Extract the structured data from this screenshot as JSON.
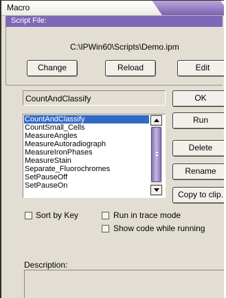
{
  "window": {
    "title": "Macro"
  },
  "script_file": {
    "header": "Script File:",
    "path": "C:\\IPWin60\\Scripts\\Demo.ipm",
    "buttons": {
      "change": "Change",
      "reload": "Reload",
      "edit": "Edit"
    }
  },
  "macro_combo": {
    "value": "CountAndClassify"
  },
  "macro_list": {
    "items": [
      "CountAndClassify",
      "CountSmall_Cells",
      "MeasureAngles",
      "MeasureAutoradiograph",
      "MeasureIronPhases",
      "MeasureStain",
      "Separate_Fluorochromes",
      "SetPauseOff",
      "SetPauseOn"
    ],
    "selected": "CountAndClassify"
  },
  "side_buttons": {
    "ok": "OK",
    "run": "Run",
    "delete": "Delete",
    "rename": "Rename",
    "copy": "Copy to clip."
  },
  "options": {
    "sort_by_key": {
      "label": "Sort by Key",
      "checked": false
    },
    "run_trace": {
      "label": "Run in trace mode",
      "checked": false
    },
    "show_code": {
      "label": "Show code while running",
      "checked": false
    }
  },
  "description": {
    "label": "Description:",
    "value": ""
  },
  "colors": {
    "accent": "#7d68b7",
    "selection": "#316ac5",
    "face": "#e3ded3"
  }
}
